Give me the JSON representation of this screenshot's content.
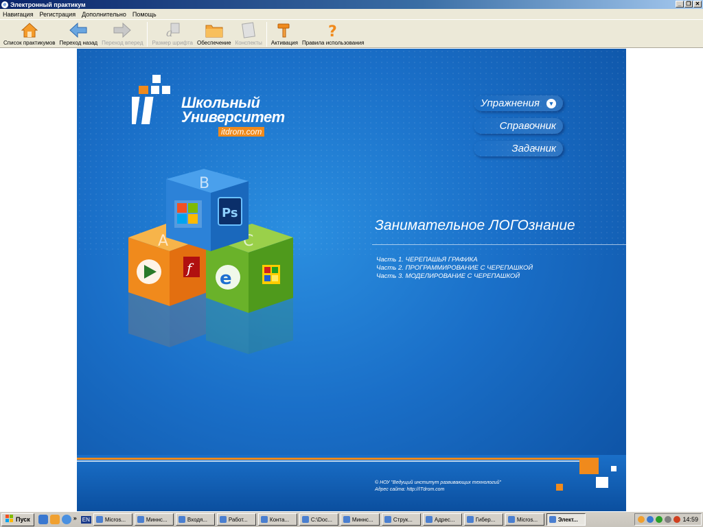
{
  "window": {
    "title": "Электронный практикум",
    "minimize": "_",
    "maximize": "❐",
    "close": "✕"
  },
  "menubar": [
    "Навигация",
    "Регистрация",
    "Дополнительно",
    "Помощь"
  ],
  "toolbar": [
    {
      "label": "Список практикумов",
      "icon": "home-icon",
      "enabled": true
    },
    {
      "label": "Переход назад",
      "icon": "back-arrow-icon",
      "enabled": true
    },
    {
      "label": "Переход вперед",
      "icon": "forward-arrow-icon",
      "enabled": false
    },
    {
      "label": "Размер шрифта",
      "icon": "font-size-icon",
      "enabled": false
    },
    {
      "label": "Обеспечение",
      "icon": "folder-icon",
      "enabled": true
    },
    {
      "label": "Конспекты",
      "icon": "notes-icon",
      "enabled": false
    },
    {
      "label": "Активация",
      "icon": "hammer-icon",
      "enabled": true
    },
    {
      "label": "Правила использования",
      "icon": "help-icon",
      "enabled": true
    }
  ],
  "logo": {
    "line1": "Школьный",
    "line2": "Университет",
    "url": "itdrom.com"
  },
  "nav_links": {
    "exercises": "Упражнения",
    "reference": "Справочник",
    "problems": "Задачник"
  },
  "course": {
    "title": "Занимательное ЛОГОзнание",
    "parts": [
      "Часть 1. ЧЕРЕПАШЬЯ ГРАФИКА",
      "Часть 2. ПРОГРАММИРОВАНИЕ С ЧЕРЕПАШКОЙ",
      "Часть 3. МОДЕЛИРОВАНИЕ С ЧЕРЕПАШКОЙ"
    ]
  },
  "cubes": {
    "top": "В",
    "left": "А",
    "right": "С"
  },
  "footer": {
    "copyright": "©  НОУ \"Ведущий институт развивающих технологий\"",
    "site": "Адрес сайта: http://ITdrom.com"
  },
  "taskbar": {
    "start": "Пуск",
    "lang": "EN",
    "tasks": [
      "Micros...",
      "Миннс...",
      "Входя...",
      "Работ...",
      "Конта...",
      "C:\\Doc...",
      "Миннс...",
      "Струк...",
      "Адрес...",
      "Гибер...",
      "Micros...",
      "Элект..."
    ],
    "active_index": 11,
    "clock": "14:59"
  },
  "colors": {
    "accent_orange": "#f08a1c",
    "stage_blue": "#1a6fc8"
  }
}
